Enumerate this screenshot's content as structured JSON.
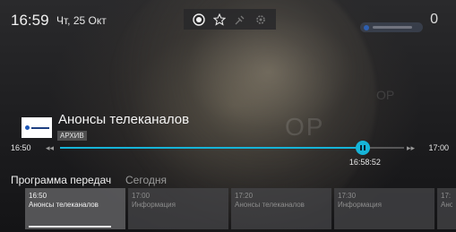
{
  "header": {
    "time": "16:59",
    "date": "Чт, 25 Окт",
    "counter": "0"
  },
  "toolbar": {
    "icons": [
      "record-icon",
      "star-icon",
      "satellite-icon",
      "gear-icon"
    ]
  },
  "program": {
    "title": "Анонсы телеканалов",
    "badge": "АРХИВ",
    "start_time": "16:50",
    "end_time": "17:00",
    "current_time": "16:58:52",
    "progress": 0.88
  },
  "guide": {
    "title": "Программа передач",
    "day": "Сегодня",
    "items": [
      {
        "time": "16:50",
        "name": "Анонсы телеканалов",
        "active": true
      },
      {
        "time": "17:00",
        "name": "Информация",
        "active": false
      },
      {
        "time": "17:20",
        "name": "Анонсы телеканалов",
        "active": false
      },
      {
        "time": "17:30",
        "name": "Информация",
        "active": false
      },
      {
        "time": "17:",
        "name": "Ано",
        "active": false
      }
    ]
  },
  "colors": {
    "accent": "#16b4d8"
  }
}
